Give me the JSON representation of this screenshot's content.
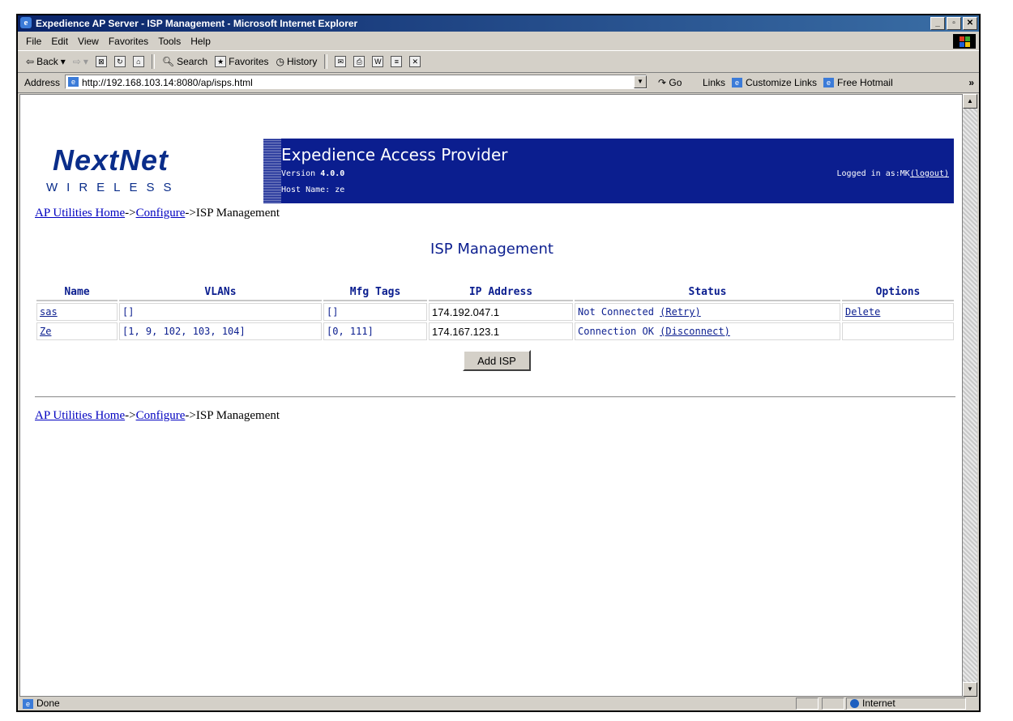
{
  "window": {
    "title": "Expedience AP Server - ISP Management - Microsoft Internet Explorer",
    "controls": [
      "_",
      "▫",
      "✕"
    ]
  },
  "menu": [
    "File",
    "Edit",
    "View",
    "Favorites",
    "Tools",
    "Help"
  ],
  "toolbar": {
    "back": "Back",
    "search": "Search",
    "favorites": "Favorites",
    "history": "History"
  },
  "address": {
    "label": "Address",
    "url": "http://192.168.103.14:8080/ap/isps.html",
    "go": "Go",
    "links": "Links",
    "customize": "Customize Links",
    "hotmail": "Free Hotmail"
  },
  "banner": {
    "logo_main": "NextNet",
    "logo_sub": "WIRELESS",
    "title": "Expedience Access Provider",
    "version_label": "Version",
    "version": "4.0.0",
    "host_label": "Host Name: ze",
    "login_label": "Logged in as:MK",
    "logout": "(logout)"
  },
  "breadcrumb": {
    "home": "AP Utilities Home",
    "sep": "->",
    "configure": "Configure",
    "current": "->ISP Management"
  },
  "page_title": "ISP Management",
  "table": {
    "headers": [
      "Name",
      "VLANs",
      "Mfg Tags",
      "IP Address",
      "Status",
      "Options"
    ],
    "rows": [
      {
        "name": "sas",
        "vlans": "[]",
        "mfg": "[]",
        "ip": "174.192.047.1",
        "status": "Not Connected",
        "action": "(Retry)",
        "option": "Delete"
      },
      {
        "name": "Ze",
        "vlans": "[1, 9, 102, 103, 104]",
        "mfg": "[0, 111]",
        "ip": "174.167.123.1",
        "status": "Connection OK",
        "action": "(Disconnect)",
        "option": ""
      }
    ]
  },
  "add_button": "Add ISP",
  "status": {
    "left": "Done",
    "zone": "Internet"
  }
}
